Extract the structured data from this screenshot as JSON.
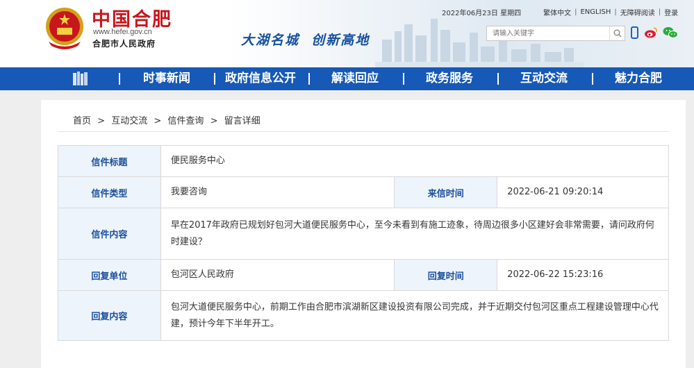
{
  "header": {
    "logo_title": "中国合肥",
    "logo_url": "www.hefei.gov.cn",
    "logo_subtitle": "合肥市人民政府",
    "slogan": "大湖名城  创新高地",
    "date": "2022年06月23日 星期四",
    "links": [
      "繁体中文",
      "ENGLISH",
      "无障碍阅读",
      "登录"
    ],
    "search_placeholder": "请输入关键字",
    "icons": [
      "search-icon",
      "mobile-icon",
      "weibo-icon",
      "wechat-icon"
    ]
  },
  "nav": {
    "home_icon": "home-books-icon",
    "items": [
      "时事新闻",
      "政府信息公开",
      "解读回应",
      "政务服务",
      "互动交流",
      "魅力合肥"
    ]
  },
  "breadcrumb": [
    "首页",
    "互动交流",
    "信件查询",
    "留言详细"
  ],
  "letter": {
    "title_label": "信件标题",
    "title": "便民服务中心",
    "type_label": "信件类型",
    "type": "我要咨询",
    "time_label": "来信时间",
    "time": "2022-06-21 09:20:14",
    "content_label": "信件内容",
    "content": "早在2017年政府已规划好包河大道便民服务中心，至今未看到有施工迹象，待周边很多小区建好会非常需要，请问政府何时建设？",
    "reply_unit_label": "回复单位",
    "reply_unit": "包河区人民政府",
    "reply_time_label": "回复时间",
    "reply_time": "2022-06-22 15:23:16",
    "reply_content_label": "回复内容",
    "reply_content": "包河大道便民服务中心，前期工作由合肥市滨湖新区建设投资有限公司完成，并于近期交付包河区重点工程建设管理中心代建，预计今年下半年开工。"
  },
  "colors": {
    "nav_blue": "#1759b6",
    "brand_red": "#c8161d",
    "label_blue": "#1a4f9c",
    "label_bg": "#eef4fb"
  }
}
